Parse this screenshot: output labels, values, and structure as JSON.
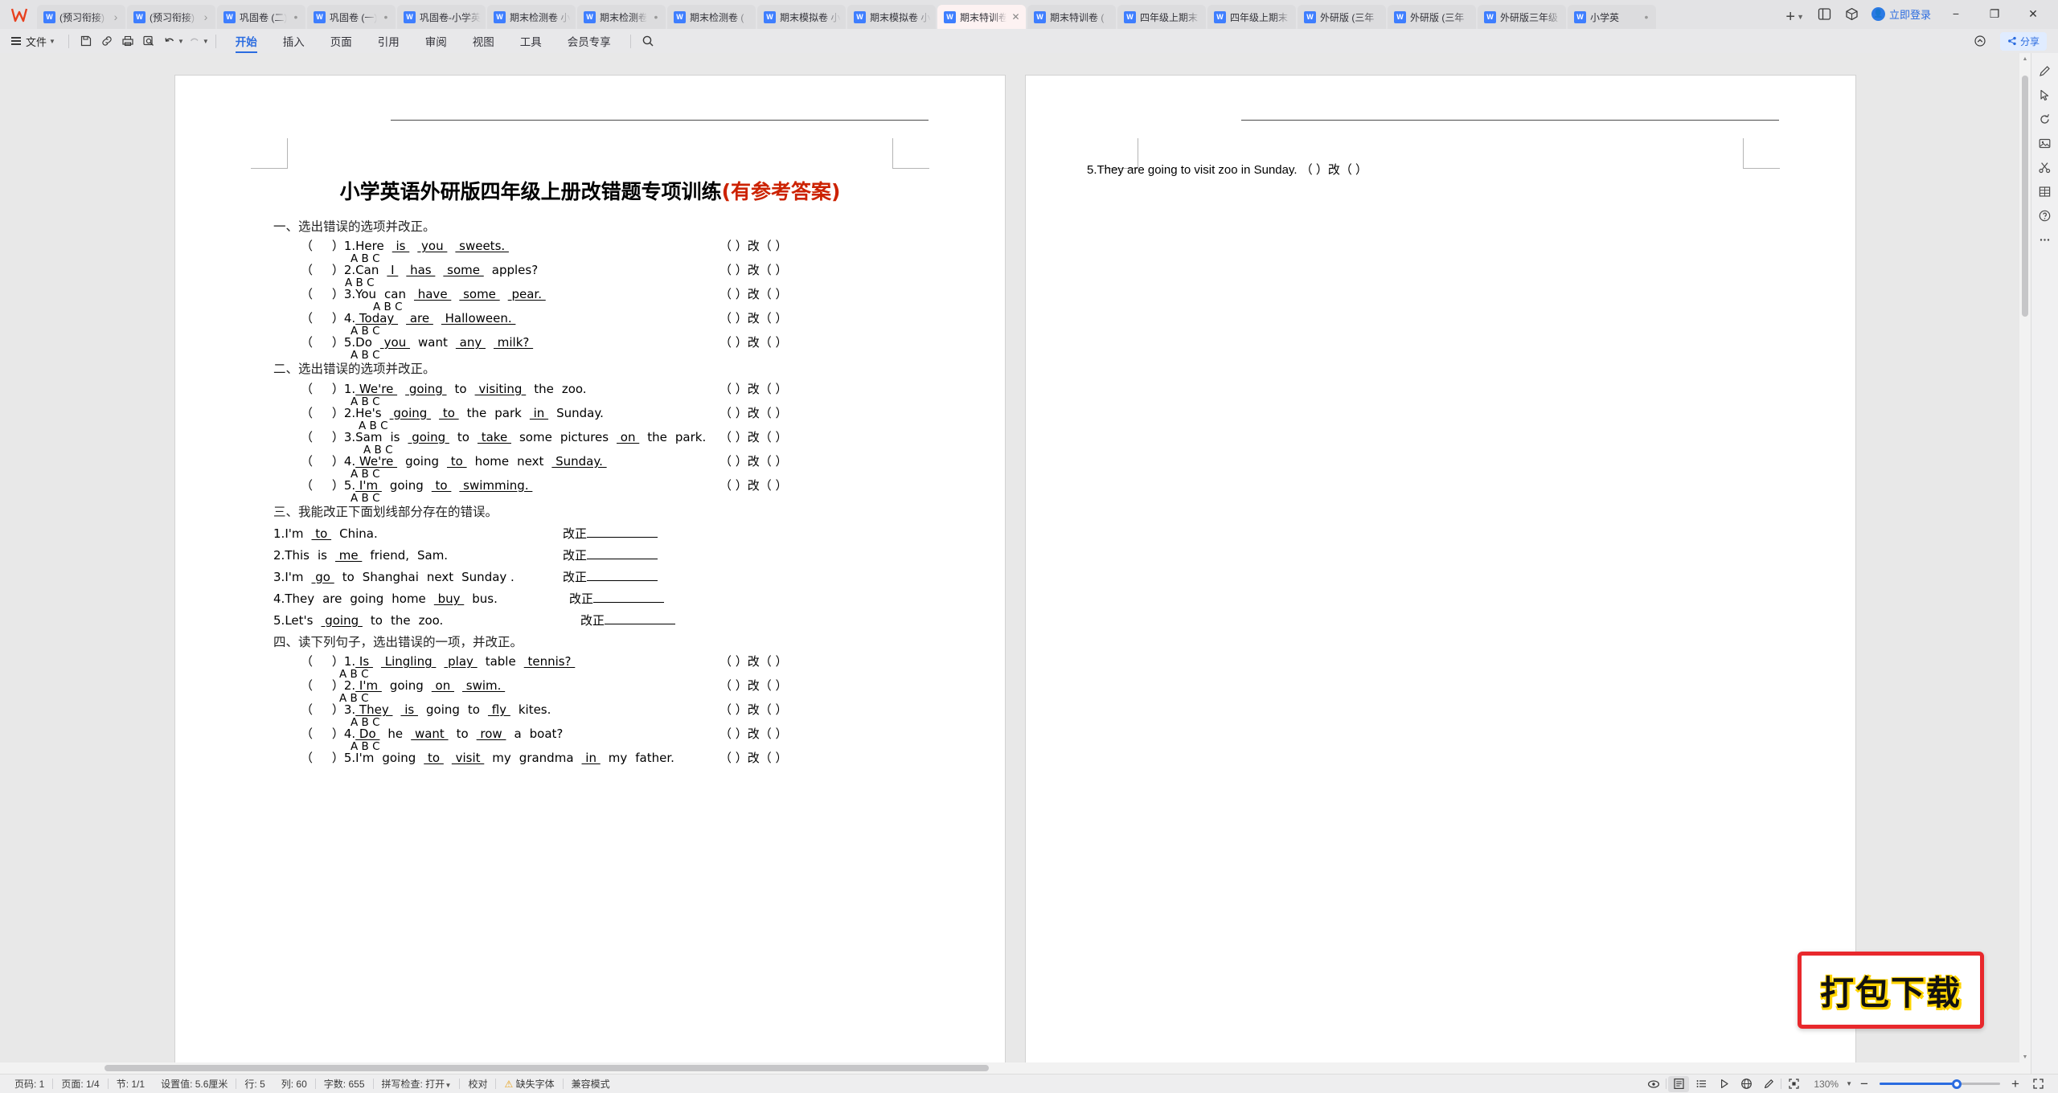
{
  "app": {
    "logo_text": "W"
  },
  "tabbar": {
    "tabs": [
      {
        "label": "(预习衔接)",
        "icon": "word-doc-icon",
        "active": false,
        "trailing": "chevron"
      },
      {
        "label": "(预习衔接)",
        "icon": "word-doc-icon",
        "active": false,
        "trailing": "chevron"
      },
      {
        "label": "巩固卷 (二)",
        "icon": "word-doc-icon",
        "active": false,
        "trailing": "dot"
      },
      {
        "label": "巩固卷 (一)",
        "icon": "word-doc-icon",
        "active": false,
        "trailing": "dot"
      },
      {
        "label": "巩固卷-小学英",
        "icon": "word-doc-icon",
        "active": false,
        "trailing": ""
      },
      {
        "label": "期末检测卷 小",
        "icon": "word-doc-icon",
        "active": false,
        "trailing": ""
      },
      {
        "label": "期末检测卷",
        "icon": "word-doc-icon",
        "active": false,
        "trailing": "dot"
      },
      {
        "label": "期末检测卷 (",
        "icon": "word-doc-icon",
        "active": false,
        "trailing": ""
      },
      {
        "label": "期末模拟卷 小",
        "icon": "word-doc-icon",
        "active": false,
        "trailing": ""
      },
      {
        "label": "期末模拟卷 小",
        "icon": "word-doc-icon",
        "active": false,
        "trailing": ""
      },
      {
        "label": "期末特训卷",
        "icon": "word-doc-icon",
        "active": true,
        "trailing": "close"
      },
      {
        "label": "期末特训卷 (",
        "icon": "word-doc-icon",
        "active": false,
        "trailing": ""
      },
      {
        "label": "四年级上期末",
        "icon": "word-doc-icon",
        "active": false,
        "trailing": ""
      },
      {
        "label": "四年级上期末",
        "icon": "word-doc-icon",
        "active": false,
        "trailing": ""
      },
      {
        "label": "外研版 (三年",
        "icon": "word-doc-icon",
        "active": false,
        "trailing": ""
      },
      {
        "label": "外研版 (三年",
        "icon": "word-doc-icon",
        "active": false,
        "trailing": ""
      },
      {
        "label": "外研版三年级",
        "icon": "word-doc-icon",
        "active": false,
        "trailing": ""
      },
      {
        "label": "小学英",
        "icon": "word-doc-icon",
        "active": false,
        "trailing": "dot"
      }
    ],
    "new_tab_label": "+",
    "right": {
      "sidebar_icon": "panel-layout-icon",
      "package_icon": "cube-icon",
      "login_label": "立即登录",
      "minimize": "−",
      "maximize": "❐",
      "close": "✕"
    }
  },
  "ribbon": {
    "file_label": "文件",
    "quick_access": [
      "save-icon",
      "link-icon",
      "print-icon",
      "print-preview-icon",
      "undo-icon",
      "redo-icon",
      "customize-chevron-icon"
    ],
    "tabs": [
      {
        "label": "开始",
        "active": true
      },
      {
        "label": "插入",
        "active": false
      },
      {
        "label": "页面",
        "active": false
      },
      {
        "label": "引用",
        "active": false
      },
      {
        "label": "审阅",
        "active": false
      },
      {
        "label": "视图",
        "active": false
      },
      {
        "label": "工具",
        "active": false
      },
      {
        "label": "会员专享",
        "active": false
      }
    ],
    "search_icon": "search-icon",
    "collapse_icon": "collapse-ribbon-icon",
    "share_label": "分享",
    "accent_color": "#2b6ce0"
  },
  "document": {
    "title_main": "小学英语外研版四年级上册改错题专项训练",
    "title_suffix": "(有参考答案)",
    "title_suffix_color": "#cc2200",
    "sections": [
      {
        "heading": "一、选出错误的选项并改正。"
      },
      {
        "heading": "二、选出错误的选项并改正。"
      },
      {
        "heading": "三、我能改正下面划线部分存在的错误。"
      },
      {
        "heading": "四、读下列句子，选出错误的一项，并改正。"
      }
    ],
    "answer_tail": "（    ）改（      ）",
    "fix_label": "改正",
    "section1": [
      {
        "num": "1.",
        "parts": [
          {
            "t": "Here",
            "u": false
          },
          {
            "t": "is",
            "u": true
          },
          {
            "t": "you",
            "u": true
          },
          {
            "t": "sweets.",
            "u": true
          }
        ],
        "opts": "A            B            C"
      },
      {
        "num": "2.",
        "parts": [
          {
            "t": "Can",
            "u": false
          },
          {
            "t": "I",
            "u": true
          },
          {
            "t": "has",
            "u": true
          },
          {
            "t": "some",
            "u": true
          },
          {
            "t": "apples?",
            "u": false
          }
        ],
        "opts": "A        B        C"
      },
      {
        "num": "3.",
        "parts": [
          {
            "t": "You",
            "u": false
          },
          {
            "t": "can",
            "u": false
          },
          {
            "t": "have",
            "u": true
          },
          {
            "t": "some",
            "u": true
          },
          {
            "t": "pear.",
            "u": true
          }
        ],
        "opts": "A          B          C"
      },
      {
        "num": "4.",
        "parts": [
          {
            "t": "Today",
            "u": true
          },
          {
            "t": "are",
            "u": true
          },
          {
            "t": "Halloween.",
            "u": true
          }
        ],
        "opts": "A        B          C"
      },
      {
        "num": "5.",
        "parts": [
          {
            "t": "Do",
            "u": false
          },
          {
            "t": "you",
            "u": true
          },
          {
            "t": "want",
            "u": false
          },
          {
            "t": "any",
            "u": true
          },
          {
            "t": "milk?",
            "u": true
          }
        ],
        "opts": "A                  B        C"
      }
    ],
    "section2": [
      {
        "num": "1.",
        "parts": [
          {
            "t": "We're",
            "u": true
          },
          {
            "t": "going",
            "u": true
          },
          {
            "t": "to",
            "u": false
          },
          {
            "t": "visiting",
            "u": true
          },
          {
            "t": "the",
            "u": false
          },
          {
            "t": "zoo.",
            "u": false
          }
        ],
        "opts": "A        B                C"
      },
      {
        "num": "2.",
        "parts": [
          {
            "t": "He's",
            "u": false
          },
          {
            "t": "going",
            "u": true
          },
          {
            "t": "to",
            "u": true
          },
          {
            "t": "the",
            "u": false
          },
          {
            "t": "park",
            "u": false
          },
          {
            "t": "in",
            "u": true
          },
          {
            "t": "Sunday.",
            "u": false
          }
        ],
        "opts": "A      B                      C"
      },
      {
        "num": "3.",
        "parts": [
          {
            "t": "Sam",
            "u": false
          },
          {
            "t": "is",
            "u": false
          },
          {
            "t": "going",
            "u": true
          },
          {
            "t": "to",
            "u": false
          },
          {
            "t": "take",
            "u": true
          },
          {
            "t": "some",
            "u": false
          },
          {
            "t": "pictures",
            "u": false
          },
          {
            "t": "on",
            "u": true
          },
          {
            "t": "the",
            "u": false
          },
          {
            "t": "park.",
            "u": false
          }
        ],
        "opts": "A              B                        C"
      },
      {
        "num": "4.",
        "parts": [
          {
            "t": "We're",
            "u": true
          },
          {
            "t": "going",
            "u": false
          },
          {
            "t": "to",
            "u": true
          },
          {
            "t": "home",
            "u": false
          },
          {
            "t": "next",
            "u": false
          },
          {
            "t": "Sunday.",
            "u": true
          }
        ],
        "opts": "A            B                          C"
      },
      {
        "num": "5.",
        "parts": [
          {
            "t": "I'm",
            "u": true
          },
          {
            "t": "going",
            "u": false
          },
          {
            "t": "to",
            "u": true
          },
          {
            "t": "swimming.",
            "u": true
          }
        ],
        "opts": "A          B          C"
      }
    ],
    "section3": [
      {
        "num": "1.",
        "text_parts": [
          {
            "t": "I'm",
            "u": false
          },
          {
            "t": "to",
            "u": true
          },
          {
            "t": "China.",
            "u": false
          }
        ]
      },
      {
        "num": "2.",
        "text_parts": [
          {
            "t": "This",
            "u": false
          },
          {
            "t": "is",
            "u": false
          },
          {
            "t": "me",
            "u": true
          },
          {
            "t": "friend,",
            "u": false
          },
          {
            "t": "Sam.",
            "u": false
          }
        ]
      },
      {
        "num": "3.",
        "text_parts": [
          {
            "t": "I'm",
            "u": false
          },
          {
            "t": "go",
            "u": true
          },
          {
            "t": "to",
            "u": false
          },
          {
            "t": "Shanghai",
            "u": false
          },
          {
            "t": "next",
            "u": false
          },
          {
            "t": "Sunday .",
            "u": false
          }
        ]
      },
      {
        "num": "4.",
        "text_parts": [
          {
            "t": "They",
            "u": false
          },
          {
            "t": "are",
            "u": false
          },
          {
            "t": "going",
            "u": false
          },
          {
            "t": "home",
            "u": false
          },
          {
            "t": "buy",
            "u": true
          },
          {
            "t": "bus.",
            "u": false
          }
        ]
      },
      {
        "num": "5.",
        "text_parts": [
          {
            "t": "Let's",
            "u": false
          },
          {
            "t": "going",
            "u": true
          },
          {
            "t": "to",
            "u": false
          },
          {
            "t": "the",
            "u": false
          },
          {
            "t": "zoo.",
            "u": false
          }
        ]
      }
    ],
    "section4": [
      {
        "num": "1.",
        "parts": [
          {
            "t": "Is",
            "u": true
          },
          {
            "t": "Lingling",
            "u": true
          },
          {
            "t": "play",
            "u": true
          },
          {
            "t": "table",
            "u": false
          },
          {
            "t": "tennis?",
            "u": true
          }
        ],
        "opts": "A                B                C"
      },
      {
        "num": "2.",
        "parts": [
          {
            "t": "I'm",
            "u": true
          },
          {
            "t": "going",
            "u": false
          },
          {
            "t": "on",
            "u": true
          },
          {
            "t": "swim.",
            "u": true
          }
        ],
        "opts": "A            B          C"
      },
      {
        "num": "3.",
        "parts": [
          {
            "t": "They",
            "u": true
          },
          {
            "t": "is",
            "u": true
          },
          {
            "t": "going",
            "u": false
          },
          {
            "t": "to",
            "u": false
          },
          {
            "t": "fly",
            "u": true
          },
          {
            "t": "kites.",
            "u": false
          }
        ],
        "opts": "A        B                    C"
      },
      {
        "num": "4.",
        "parts": [
          {
            "t": "Do",
            "u": true
          },
          {
            "t": "he",
            "u": false
          },
          {
            "t": "want",
            "u": true
          },
          {
            "t": "to",
            "u": false
          },
          {
            "t": "row",
            "u": true
          },
          {
            "t": "a",
            "u": false
          },
          {
            "t": "boat?",
            "u": false
          }
        ],
        "opts": "A              B              C"
      },
      {
        "num": "5.",
        "parts": [
          {
            "t": "I'm",
            "u": false
          },
          {
            "t": "going",
            "u": false
          },
          {
            "t": "to",
            "u": true
          },
          {
            "t": "visit",
            "u": true
          },
          {
            "t": "my",
            "u": false
          },
          {
            "t": "grandma",
            "u": false
          },
          {
            "t": "in",
            "u": true
          },
          {
            "t": "my",
            "u": false
          },
          {
            "t": "father.",
            "u": false
          }
        ],
        "opts": ""
      }
    ],
    "page2_line": "5.They    are    going    to    visit    zoo    in    Sunday.     （     ）改（     ）"
  },
  "watermark": {
    "label": "打包下载",
    "border_color": "#e8282c",
    "shadow_color": "#ffd400"
  },
  "status": {
    "page_number": "页码: 1",
    "page_of": "页面: 1/4",
    "section": "节: 1/1",
    "setting": "设置值: 5.6厘米",
    "row": "行: 5",
    "col": "列: 60",
    "word_count": "字数: 655",
    "spellcheck": "拼写检查: 打开",
    "proof": "校对",
    "missing_font": "缺失字体",
    "compat_mode": "兼容模式",
    "zoom_level": "130%",
    "view_icons": [
      "eye-icon",
      "page-view-icon",
      "outline-view-icon",
      "play-view-icon",
      "web-view-icon",
      "brush-icon",
      "focus-icon"
    ],
    "zoom_minus": "−",
    "zoom_plus": "+",
    "fullscreen_icon": "fullscreen-icon"
  },
  "rail": {
    "items": [
      "pen-icon",
      "cursor-icon",
      "rotate-icon",
      "picture-icon",
      "scissors-icon",
      "table-icon",
      "help-icon",
      "more-icon"
    ]
  }
}
